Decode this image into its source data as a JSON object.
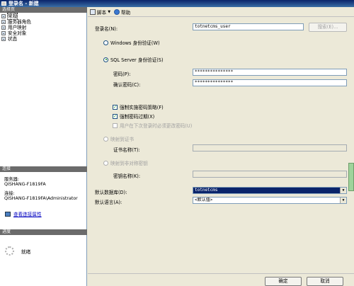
{
  "window": {
    "title": "登录名 - 新建"
  },
  "left": {
    "pages_header": "选择页",
    "pages": [
      "常规",
      "服务器角色",
      "用户映射",
      "安全对象",
      "状态"
    ],
    "connection_header": "连接",
    "server_label": "服务器:",
    "server_value": "QISHANG-F1819FA",
    "conn_label": "连接:",
    "conn_value": "QISHANG-F1819FA\\Administrator",
    "view_props": "查看连接属性",
    "progress_header": "进度",
    "progress_status": "就绪"
  },
  "toolbar": {
    "script": "脚本",
    "help": "帮助"
  },
  "form": {
    "login_label": "登录名(N):",
    "login_value": "totnetcms_user",
    "search_button": "搜索(E)...",
    "windows_auth": "Windows 身份验证(W)",
    "sql_auth": "SQL Server 身份验证(S)",
    "password_label": "密码(P):",
    "password_value": "***************",
    "confirm_label": "确认密码(C):",
    "confirm_value": "***************",
    "enforce_policy": "强制实施密码策略(F)",
    "enforce_expiry": "强制密码过期(X)",
    "must_change": "用户在下次登录时必须更改密码(U)",
    "cert_map": "映射到证书",
    "cert_name_label": "证书名称(T):",
    "asym_map": "映射到非对称密钥",
    "key_name_label": "密钥名称(K):",
    "default_db_label": "默认数据库(D):",
    "default_db_value": "totnetcms",
    "default_lang_label": "默认语言(A):",
    "default_lang_value": "<默认值>"
  },
  "buttons": {
    "ok": "确定",
    "cancel": "取消"
  }
}
